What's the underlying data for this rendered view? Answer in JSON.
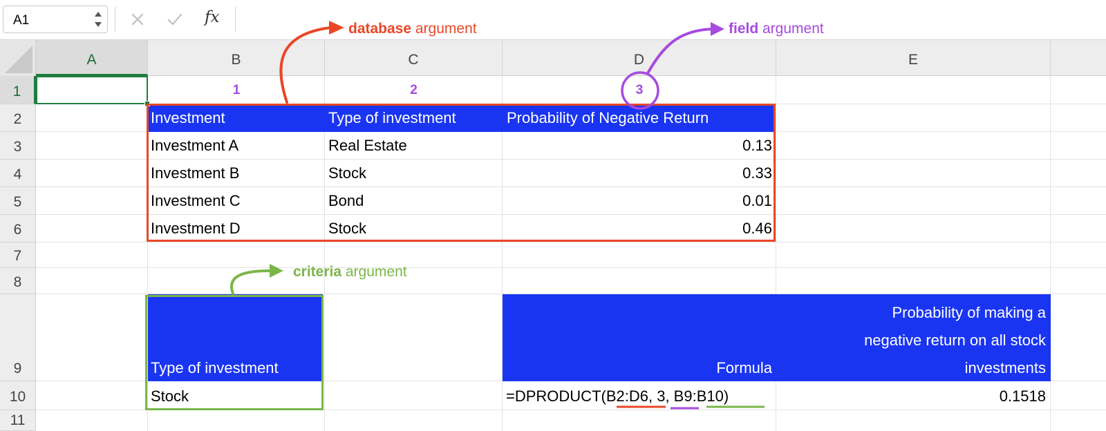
{
  "formula_bar": {
    "name_box": "A1",
    "cancel_icon": "cancel-x-icon",
    "enter_icon": "checkmark-icon",
    "function_label": "fx",
    "formula": ""
  },
  "columns": [
    "A",
    "B",
    "C",
    "D",
    "E"
  ],
  "rows": [
    "1",
    "2",
    "3",
    "4",
    "5",
    "6",
    "7",
    "8",
    "9",
    "10",
    "11"
  ],
  "field_numbers": [
    "1",
    "2",
    "3"
  ],
  "database": {
    "headers": [
      "Investment",
      "Type of investment",
      "Probability of Negative Return"
    ],
    "records": [
      {
        "investment": "Investment A",
        "type": "Real Estate",
        "probability": "0.13"
      },
      {
        "investment": "Investment B",
        "type": "Stock",
        "probability": "0.33"
      },
      {
        "investment": "Investment C",
        "type": "Bond",
        "probability": "0.01"
      },
      {
        "investment": "Investment D",
        "type": "Stock",
        "probability": "0.46"
      }
    ]
  },
  "criteria": {
    "header": "Type of investment",
    "value": "Stock"
  },
  "result": {
    "formula_header": "Formula",
    "result_header_lines": [
      "Probability of making a",
      "negative return on all stock",
      "investments"
    ],
    "formula_text": "=DPRODUCT(B2:D6, 3, B9:B10)",
    "value": "0.1518"
  },
  "annotations": {
    "database": {
      "bold": "database",
      "rest": " argument",
      "color": "#ea4727"
    },
    "field": {
      "bold": "field",
      "rest": " argument",
      "color": "#a64ae0"
    },
    "criteria": {
      "bold": "criteria",
      "rest": "  argument",
      "color": "#7ab648"
    }
  },
  "colors": {
    "header_fill": "#1a35f2",
    "selection": "#1f7d3f",
    "database_outline": "#ea4727",
    "field_marker": "#a64ae0",
    "criteria_outline": "#7ab648"
  }
}
